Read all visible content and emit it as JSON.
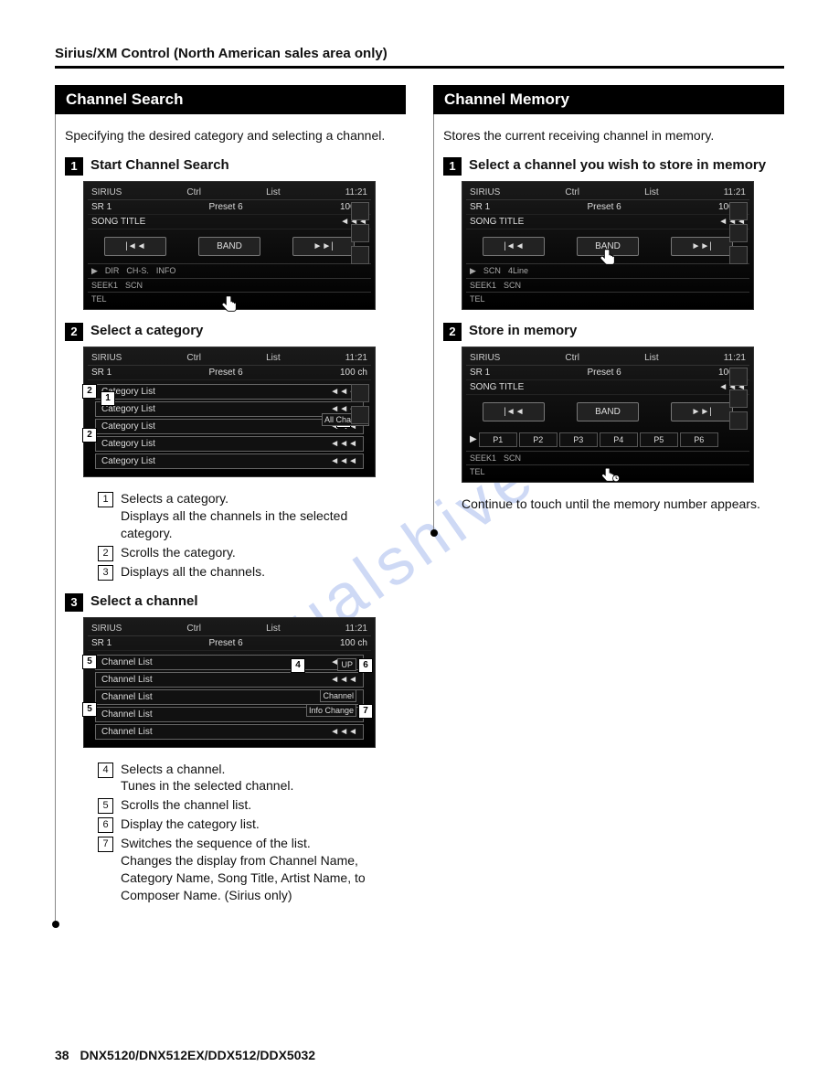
{
  "header": "Sirius/XM Control (North American sales area only)",
  "watermark": "manualshive.com",
  "footer": {
    "page": "38",
    "models": "DNX5120/DNX512EX/DDX512/DDX5032"
  },
  "left": {
    "title": "Channel Search",
    "intro": "Specifying the desired category and selecting a channel.",
    "step1": "Start Channel Search",
    "step2": "Select a category",
    "step3": "Select a channel",
    "defs1": {
      "n1": "Selects a category.",
      "n1b": "Displays all the channels in the selected category.",
      "n2": "Scrolls the category.",
      "n3": "Displays all the channels."
    },
    "defs2": {
      "n4": "Selects a channel.",
      "n4b": "Tunes in the selected channel.",
      "n5": "Scrolls the channel list.",
      "n6": "Display the category list.",
      "n7": "Switches the sequence of the list.",
      "n7b": "Changes the display from Channel Name, Category Name, Song Title, Artist Name, to Composer Name. (Sirius only)"
    }
  },
  "right": {
    "title": "Channel Memory",
    "intro": "Stores the current receiving channel in memory.",
    "step1": "Select a channel you wish to store in memory",
    "step2": "Store in memory",
    "after": "Continue to touch until the memory number appears."
  },
  "screen": {
    "source": "SIRIUS",
    "ctrl": "Ctrl",
    "list": "List",
    "time": "11:21",
    "sr": "SR  1",
    "preset": "Preset  6",
    "ch": "100 ch",
    "songtitle": "SONG TITLE",
    "btn_prev": "|◄◄",
    "btn_band": "BAND",
    "btn_next": "►►|",
    "bottom_dir": "DIR",
    "bottom_chs": "CH-S.",
    "bottom_info": "INFO",
    "bottom_seek1": "SEEK1",
    "bottom_scn": "SCN",
    "bottom_tel": "TEL",
    "bottom_4line": "4Line",
    "catlist": "Category List",
    "allch": "All Channel",
    "chlist": "Channel List",
    "channel": "Channel",
    "infochange": "Info Change",
    "up": "UP",
    "presets": [
      "P1",
      "P2",
      "P3",
      "P4",
      "P5",
      "P6"
    ]
  }
}
